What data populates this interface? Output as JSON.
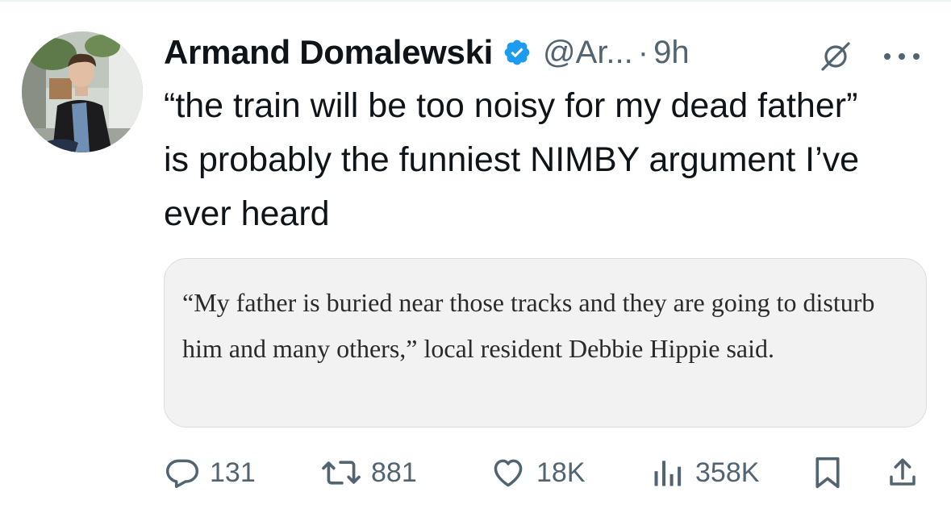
{
  "tweet": {
    "author": {
      "display_name": "Armand Domalewski",
      "handle": "@Ar...",
      "verified": true
    },
    "separator": "·",
    "time": "9h",
    "text": "“the train will be too noisy for my dead father” is probably the funniest NIMBY argument I’ve ever heard",
    "quote": {
      "text": "“My father is buried near those tracks and they are going to disturb him and many others,” local resident Debbie Hippie said."
    },
    "metrics": {
      "replies": "131",
      "reposts": "881",
      "likes": "18K",
      "views": "358K"
    }
  },
  "icons": {
    "verified": "verified-badge-icon",
    "grok": "grok-icon",
    "more": "more-options-icon",
    "reply": "reply-icon",
    "repost": "repost-icon",
    "like": "heart-icon",
    "views": "views-chart-icon",
    "bookmark": "bookmark-icon",
    "share": "share-icon"
  },
  "colors": {
    "text_primary": "#0f1419",
    "text_secondary": "#536471",
    "verified_blue": "#1d9bf0",
    "quote_background": "#f2f2f2",
    "border": "#d9dee1"
  }
}
